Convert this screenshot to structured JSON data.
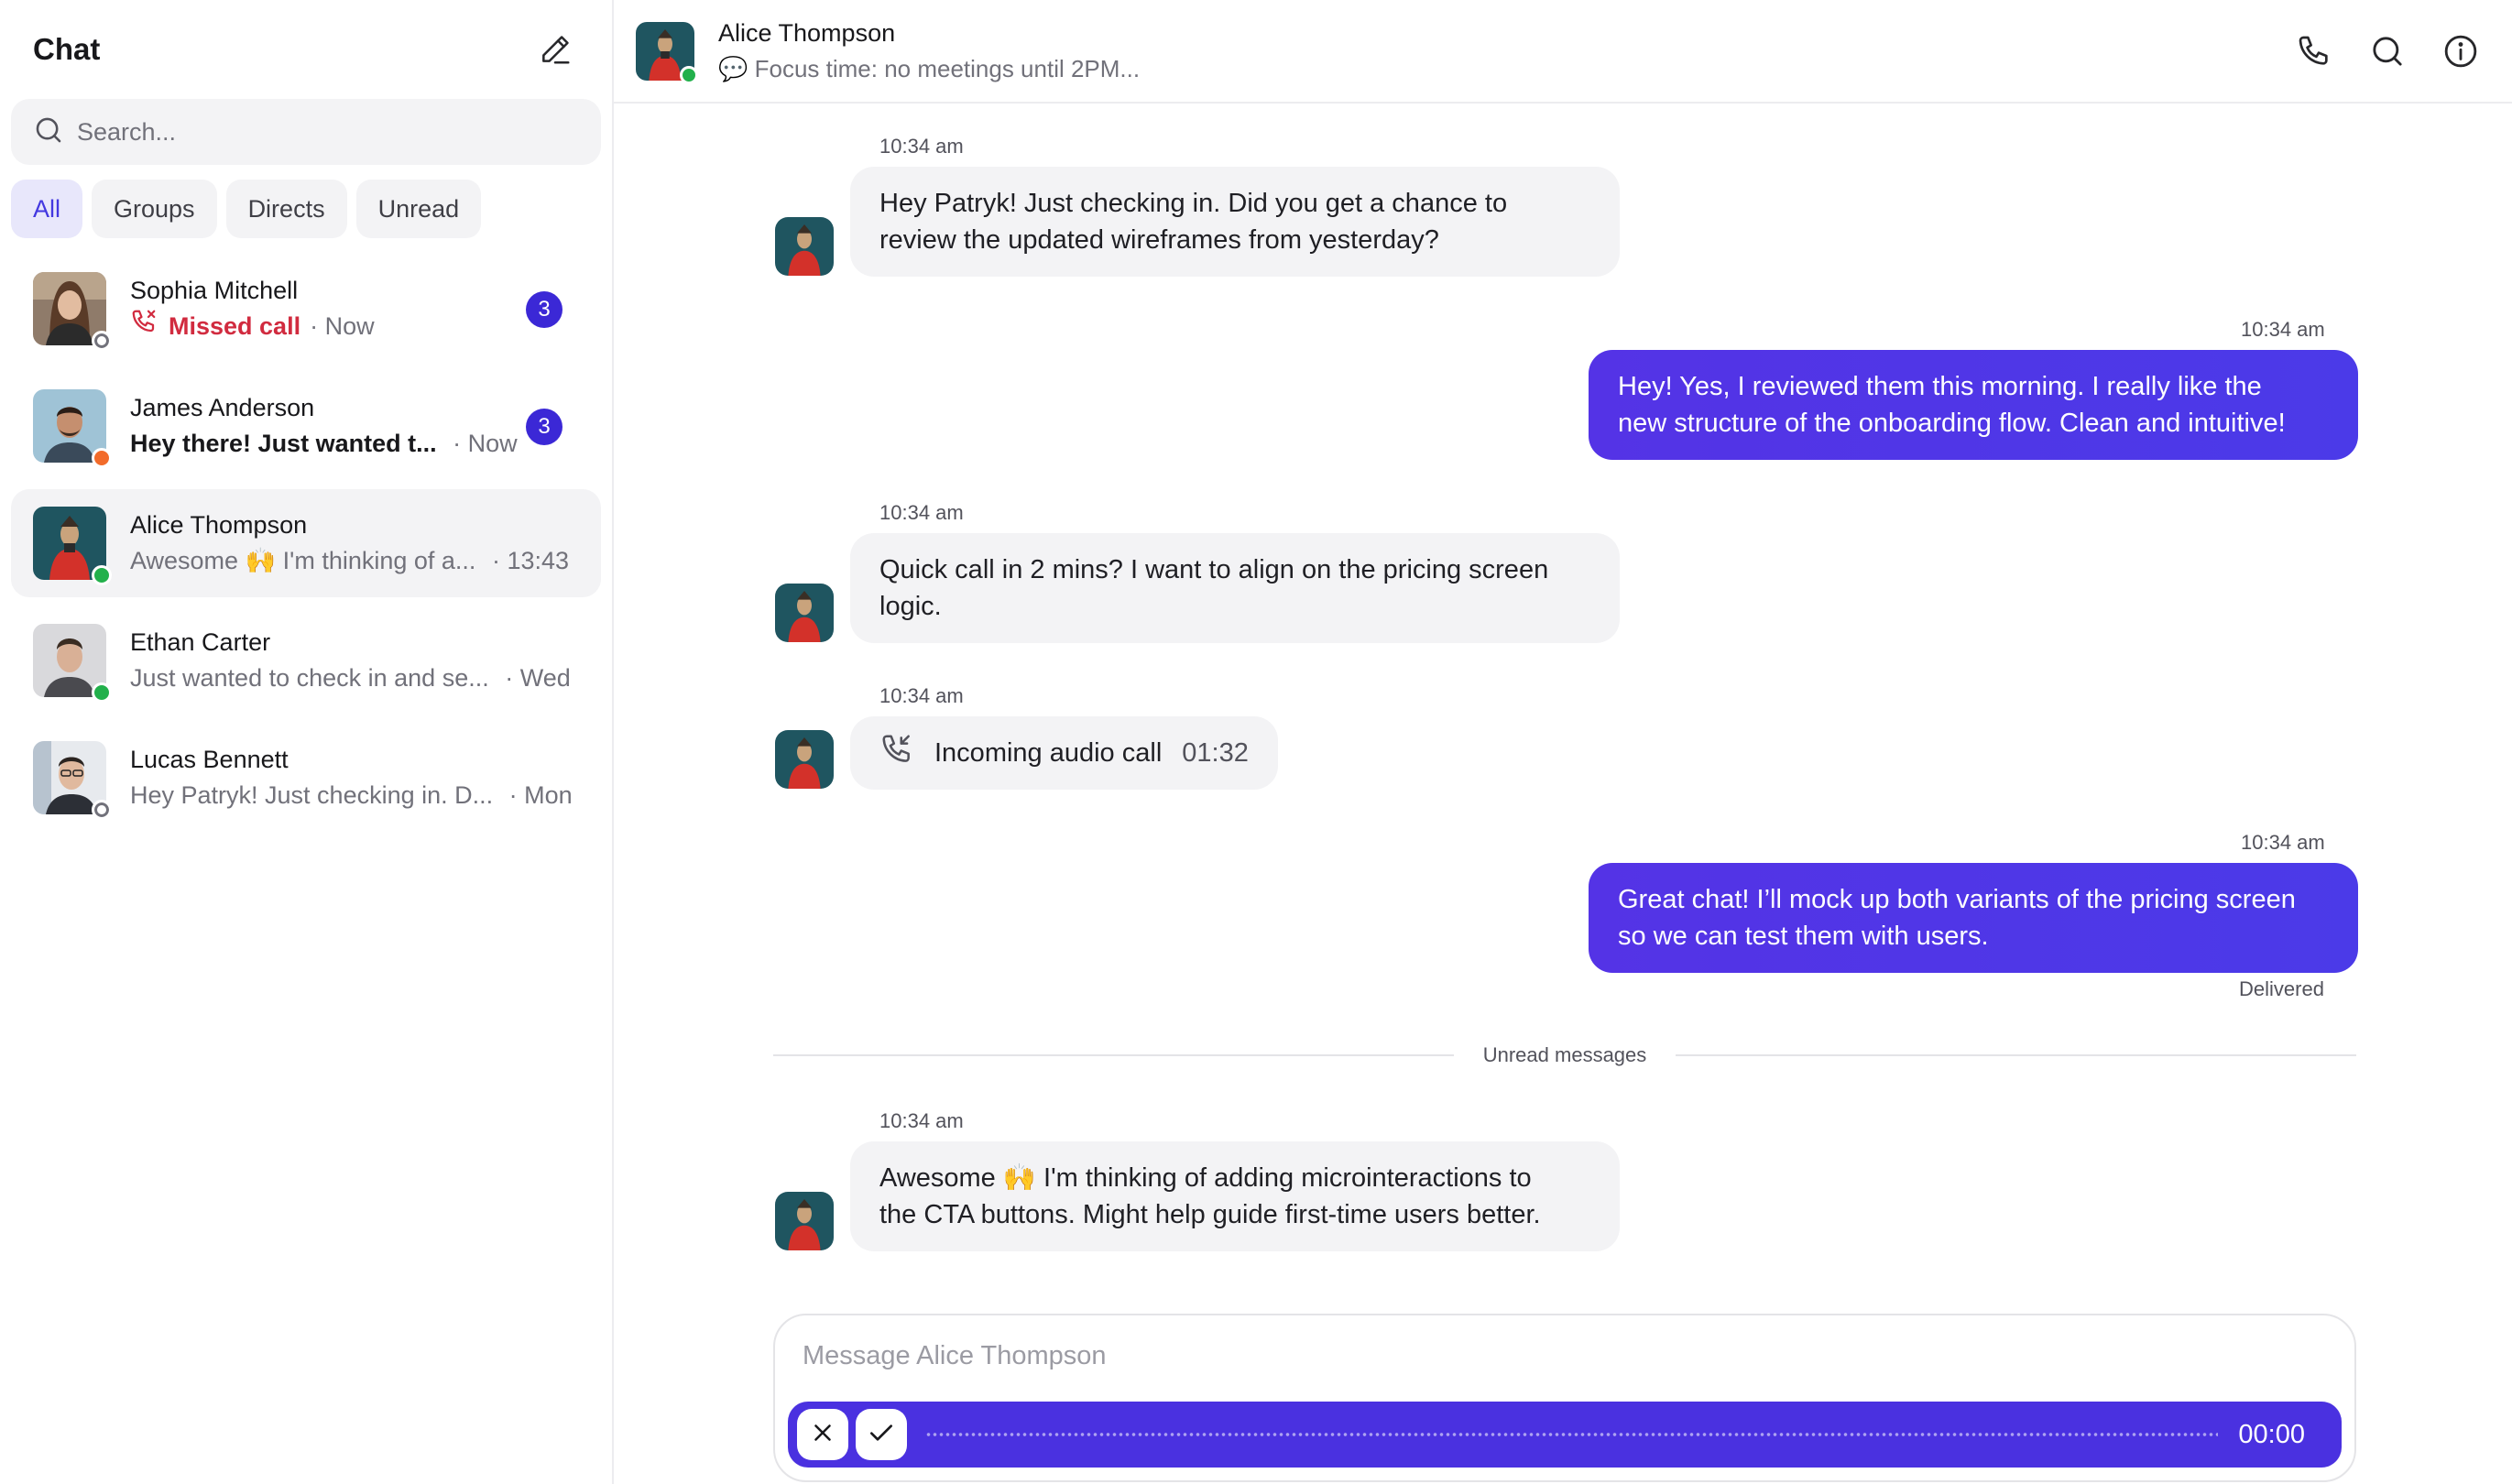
{
  "sidebar": {
    "title": "Chat",
    "search_placeholder": "Search...",
    "filters": [
      "All",
      "Groups",
      "Directs",
      "Unread"
    ],
    "active_filter": "All",
    "chats": [
      {
        "name": "Sophia Mitchell",
        "preview": "Missed call",
        "time": "Now",
        "unread": "3",
        "status": "offline",
        "missed_call": true
      },
      {
        "name": "James Anderson",
        "preview": "Hey there! Just wanted t...",
        "time": "Now",
        "unread": "3",
        "status": "away",
        "bold": true
      },
      {
        "name": "Alice Thompson",
        "preview": "Awesome 🙌 I'm thinking of a...",
        "time": "13:43",
        "status": "online",
        "selected": true
      },
      {
        "name": "Ethan Carter",
        "preview": "Just wanted to check in and se...",
        "time": "Wed",
        "status": "online"
      },
      {
        "name": "Lucas Bennett",
        "preview": "Hey Patryk! Just checking in. D...",
        "time": "Mon",
        "status": "offline"
      }
    ]
  },
  "header": {
    "name": "Alice Thompson",
    "status_text": "💬 Focus time: no meetings until 2PM..."
  },
  "messages": [
    {
      "time": "10:34 am",
      "direction": "in",
      "lines": [
        "Hey Patryk! Just checking in. Did you get a chance to",
        "review the updated wireframes from yesterday?"
      ]
    },
    {
      "time": "10:34 am",
      "direction": "out",
      "lines": [
        "Hey! Yes, I reviewed them this morning. I really like the",
        "new structure of the onboarding flow. Clean and intuitive!"
      ]
    },
    {
      "time": "10:34 am",
      "direction": "in",
      "lines": [
        "Quick call in 2 mins? I want to align on the pricing screen",
        "logic."
      ]
    },
    {
      "time": "10:34 am",
      "direction": "in",
      "call_label": "Incoming audio call",
      "call_duration": "01:32"
    },
    {
      "time": "10:34 am",
      "direction": "out",
      "lines": [
        "Great chat! I’ll mock up both variants of the pricing screen",
        "so we can test them with users."
      ],
      "receipt": "Delivered"
    },
    {
      "time": "10:34 am",
      "direction": "in",
      "lines": [
        "Awesome 🙌 I'm thinking of adding microinteractions to",
        "the CTA buttons. Might help guide first-time users better."
      ]
    }
  ],
  "divider_label": "Unread messages",
  "composer": {
    "placeholder": "Message Alice Thompson",
    "recording_time": "00:00"
  },
  "colors": {
    "accent": "#4a31e0",
    "badge": "#3b28d6",
    "missed": "#d12b3f",
    "online": "#22b04b",
    "away": "#f26b2a"
  }
}
